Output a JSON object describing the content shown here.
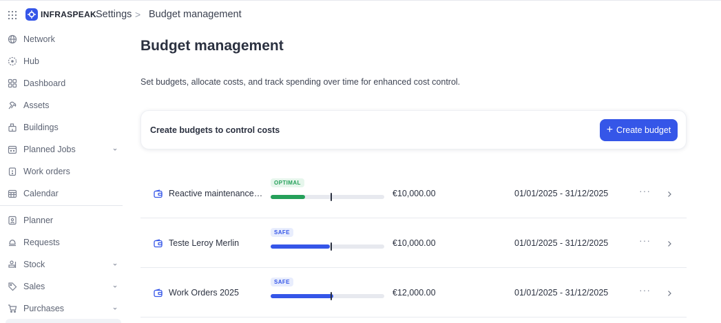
{
  "header": {
    "apps_icon": "grid-dots-icon",
    "brand": "INFRASPEAK",
    "breadcrumb": [
      "Settings",
      "Budget management"
    ],
    "separator": ">"
  },
  "sidebar": {
    "items": [
      {
        "label": "Network",
        "icon": "globe-icon",
        "has_chevron": false
      },
      {
        "label": "Hub",
        "icon": "hub-icon",
        "has_chevron": false
      },
      {
        "label": "Dashboard",
        "icon": "dashboard-icon",
        "has_chevron": false
      },
      {
        "label": "Assets",
        "icon": "assets-icon",
        "has_chevron": false
      },
      {
        "label": "Buildings",
        "icon": "building-icon",
        "has_chevron": false
      },
      {
        "label": "Planned Jobs",
        "icon": "calendar-check-icon",
        "has_chevron": true
      },
      {
        "label": "Work orders",
        "icon": "clipboard-icon",
        "has_chevron": false
      },
      {
        "label": "Calendar",
        "icon": "calendar-icon",
        "has_chevron": false
      },
      {
        "label": "Planner",
        "icon": "planner-icon",
        "has_chevron": false
      },
      {
        "label": "Requests",
        "icon": "bell-icon",
        "has_chevron": false
      },
      {
        "label": "Stock",
        "icon": "stock-icon",
        "has_chevron": true
      },
      {
        "label": "Sales",
        "icon": "tag-icon",
        "has_chevron": true
      },
      {
        "label": "Purchases",
        "icon": "cart-icon",
        "has_chevron": true
      }
    ]
  },
  "main": {
    "title": "Budget management",
    "description": "Set budgets, allocate costs, and track spending over time for enhanced cost control.",
    "cta": {
      "text": "Create budgets to control costs",
      "button_plus": "+",
      "button_label": "Create budget"
    },
    "budgets": [
      {
        "name": "Reactive maintenance b...",
        "status": "OPTIMAL",
        "status_kind": "optimal",
        "progress": 0.3,
        "marker": 0.53,
        "amount": "€10,000.00",
        "period": "01/01/2025 - 31/12/2025",
        "more": "···"
      },
      {
        "name": "Teste Leroy Merlin",
        "status": "SAFE",
        "status_kind": "safe",
        "progress": 0.52,
        "marker": 0.53,
        "amount": "€10,000.00",
        "period": "01/01/2025 - 31/12/2025",
        "more": "···"
      },
      {
        "name": "Work Orders 2025",
        "status": "SAFE",
        "status_kind": "safe",
        "progress": 0.55,
        "marker": 0.53,
        "amount": "€12,000.00",
        "period": "01/01/2025 - 31/12/2025",
        "more": "···"
      }
    ]
  },
  "colors": {
    "accent": "#3556e8",
    "optimal": "#25a05a",
    "safe": "#3556e8",
    "track": "#e7e9ef"
  }
}
